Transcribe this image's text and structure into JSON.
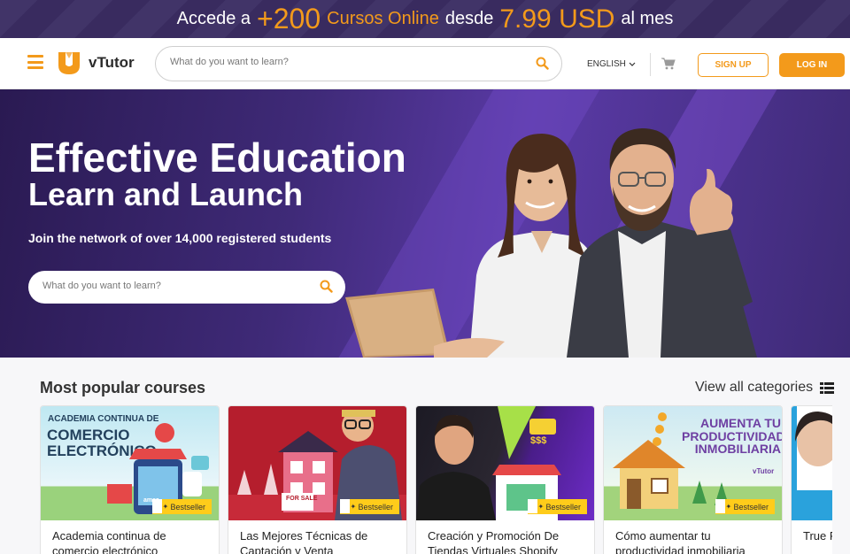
{
  "promo": {
    "part1": "Accede a",
    "part2": "+200",
    "part3": "Cursos Online",
    "part4": "desde",
    "part5": "7.99 USD",
    "part6": "al mes"
  },
  "header": {
    "logo_text": "vTutor",
    "search_placeholder": "What do you want to learn?",
    "language": "ENGLISH",
    "signup_label": "SIGN UP",
    "login_label": "LOG IN"
  },
  "hero": {
    "title_line1": "Effective Education",
    "title_line2": "Learn and Launch",
    "subtitle": "Join the network of over 14,000 registered students",
    "search_placeholder": "What do you want to learn?"
  },
  "courses": {
    "section_title": "Most popular courses",
    "view_all_label": "View all categories",
    "items": [
      {
        "title": "Academia continua de comercio electrónico",
        "badge": "Bestseller",
        "thumb_heading": "ACADEMIA CONTINUA DE",
        "thumb_big": "COMERCIO ELECTRÓNICO",
        "thumb_sign": "amaz"
      },
      {
        "title": "Las Mejores Técnicas de Captación y Venta",
        "badge": "Bestseller",
        "thumb_sign": "FOR SALE"
      },
      {
        "title": "Creación y Promoción De Tiendas Virtuales Shopify",
        "badge": "Bestseller",
        "thumb_sign": "$$$"
      },
      {
        "title": "Cómo aumentar tu productividad inmobiliaria",
        "badge": "Bestseller",
        "thumb_heading": "AUMENTA TU PRODUCTIVIDAD INMOBILIARIA",
        "thumb_logo": "vTutor"
      },
      {
        "title": "True P... Oració...",
        "badge": ""
      }
    ]
  },
  "colors": {
    "accent": "#f39a1b",
    "hero_bg": "#3f2a78",
    "badge": "#ffcc1a"
  }
}
